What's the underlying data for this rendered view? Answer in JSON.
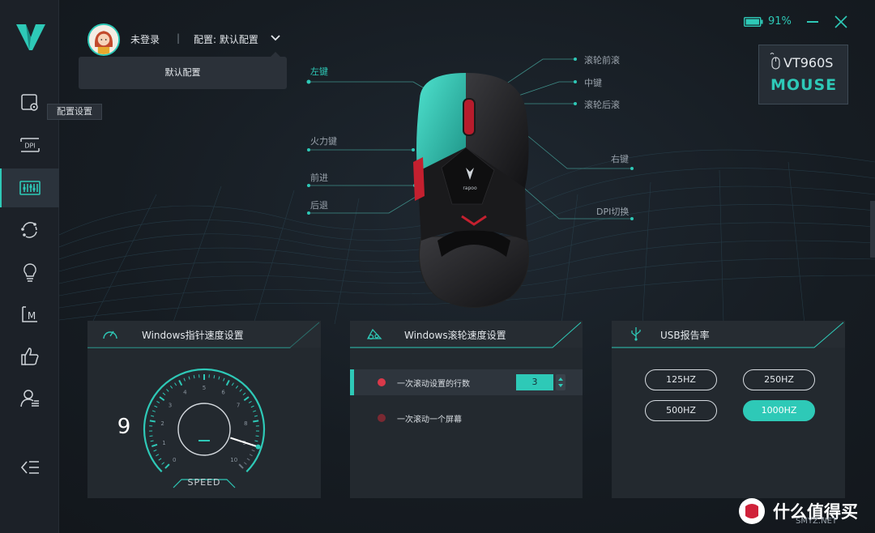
{
  "header": {
    "login_status": "未登录",
    "separator": "|",
    "profile_label": "配置: 默认配置",
    "dropdown_items": [
      "默认配置"
    ],
    "battery_percent": "91%"
  },
  "sidebar": {
    "tooltip": "配置设置",
    "items": [
      {
        "icon": "config-settings-icon"
      },
      {
        "icon": "dpi-icon",
        "label": "DPI"
      },
      {
        "icon": "key-settings-icon"
      },
      {
        "icon": "sync-icon"
      },
      {
        "icon": "light-bulb-icon"
      },
      {
        "icon": "macro-icon",
        "label": "M"
      },
      {
        "icon": "thumbs-up-icon"
      },
      {
        "icon": "user-profile-icon"
      }
    ]
  },
  "device": {
    "model": "VT960S",
    "type": "MOUSE"
  },
  "callouts": {
    "left_click": "左键",
    "fire_key": "火力键",
    "forward": "前进",
    "back": "后退",
    "scroll_up": "滚轮前滚",
    "middle": "中键",
    "scroll_down": "滚轮后滚",
    "right_click": "右键",
    "dpi_switch": "DPI切换",
    "mouse_brand": "rapoo"
  },
  "pointer_panel": {
    "title": "Windows指针速度设置",
    "speed_value": "9",
    "speed_label": "SPEED",
    "gauge_ticks": [
      "0",
      "1",
      "2",
      "3",
      "4",
      "5",
      "6",
      "7",
      "8",
      "9",
      "10"
    ],
    "gauge_level": 0.9
  },
  "scroll_panel": {
    "title": "Windows滚轮速度设置",
    "options": [
      {
        "label": "一次滚动设置的行数",
        "value": "3",
        "selected": true
      },
      {
        "label": "一次滚动一个屏幕",
        "selected": false
      }
    ]
  },
  "usb_panel": {
    "title": "USB报告率",
    "rates": [
      "125HZ",
      "250HZ",
      "500HZ",
      "1000HZ"
    ],
    "selected": "1000HZ"
  },
  "watermark": {
    "text": "什么值得买",
    "url": "SMYZ.NET"
  },
  "colors": {
    "accent": "#2ec9b7",
    "background": "#161b21",
    "panel": "#23292f",
    "red_dot": "#d9394a"
  }
}
